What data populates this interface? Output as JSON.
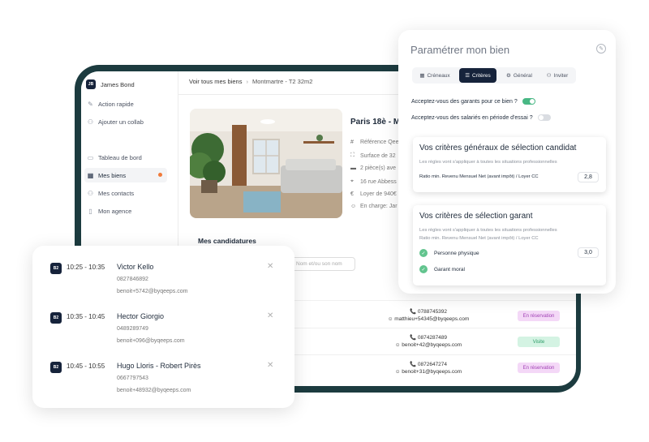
{
  "app": {
    "user": {
      "initials": "JB",
      "name": "James Bond"
    },
    "sidebar": {
      "top_items": [
        {
          "label": "Action rapide",
          "icon": "wand-icon"
        },
        {
          "label": "Ajouter un collab",
          "icon": "add-user-icon"
        }
      ],
      "nav_items": [
        {
          "label": "Tableau de bord",
          "icon": "dashboard-icon"
        },
        {
          "label": "Mes biens",
          "icon": "building-icon",
          "active": true
        },
        {
          "label": "Mes contacts",
          "icon": "contacts-icon"
        },
        {
          "label": "Mon agence",
          "icon": "agency-icon"
        }
      ]
    },
    "breadcrumb": {
      "back": "Voir tous mes biens",
      "current": "Montmartre - T2 32m2"
    },
    "property": {
      "title": "Paris 18è - Mo",
      "details": [
        {
          "icon": "hash-icon",
          "text": "Référence Qee"
        },
        {
          "icon": "area-icon",
          "text": "Surface de 32"
        },
        {
          "icon": "rooms-icon",
          "text": "2 pièce(s) ave"
        },
        {
          "icon": "location-icon",
          "text": "16 rue Abbess"
        },
        {
          "icon": "euro-icon",
          "text": "Loyer de 940€"
        },
        {
          "icon": "person-icon",
          "text": "En charge: Jar"
        }
      ]
    },
    "candidatures": {
      "title": "Mes candidatures",
      "search_placeholder": "Nom et/ou son nom",
      "rows": [
        {
          "phone": "0788745392",
          "email": "matthieu+54345@byqeeps.com",
          "status": "En réservation",
          "status_type": "resa"
        },
        {
          "phone": "0874287489",
          "email": "benoit+42@byqeeps.com",
          "status": "Visite",
          "status_type": "visite"
        },
        {
          "phone": "0872647274",
          "email": "benoit+31@byqeeps.com",
          "status": "En réservation",
          "status_type": "resa"
        }
      ]
    }
  },
  "slots": [
    {
      "badge": "B2",
      "time": "10:25 - 10:35",
      "name": "Victor Kello",
      "phone": "0827846892",
      "email": "benoit+5742@byqeeps.com"
    },
    {
      "badge": "B2",
      "time": "10:35 - 10:45",
      "name": "Hector Giorgio",
      "phone": "0489289749",
      "email": "benoit+096@byqeeps.com"
    },
    {
      "badge": "B2",
      "time": "10:45 - 10:55",
      "name": "Hugo Lloris - Robert Pirès",
      "phone": "0667797543",
      "email": "benoit+48932@byqeeps.com"
    }
  ],
  "settings": {
    "title": "Paramétrer mon bien",
    "tabs": [
      {
        "label": "Créneaux",
        "icon": "calendar-icon"
      },
      {
        "label": "Critères",
        "icon": "sliders-icon",
        "active": true
      },
      {
        "label": "Général",
        "icon": "gear-icon"
      },
      {
        "label": "Inviter",
        "icon": "add-user-icon"
      }
    ],
    "questions": [
      {
        "label": "Acceptez-vous des garants pour ce bien ?",
        "on": true
      },
      {
        "label": "Acceptez-vous des salariés en période d'essai ?",
        "on": false
      }
    ],
    "candidate_criteria": {
      "title": "Vos critères généraux de sélection candidat",
      "subtitle": "Les règles vont s'appliquer à toutes les situations professionnelles",
      "ratio_label": "Ratio min. Revenu Mensuel Net (avant impôt) / Loyer CC",
      "ratio_value": "2,8"
    },
    "guarantor_criteria": {
      "title": "Vos critères de sélection garant",
      "subtitle": "Les règles vont s'appliquer à toutes les situations professionnelles",
      "ratio_label": "Ratio min. Revenu Mensuel Net (avant impôt) / Loyer CC",
      "items": [
        {
          "label": "Personne physique",
          "value": "3,0"
        },
        {
          "label": "Garant moral",
          "value": ""
        }
      ]
    }
  },
  "colors": {
    "frame": "#1c3b3f",
    "navy": "#16233b",
    "green": "#48b784",
    "orange": "#f07a3a"
  }
}
